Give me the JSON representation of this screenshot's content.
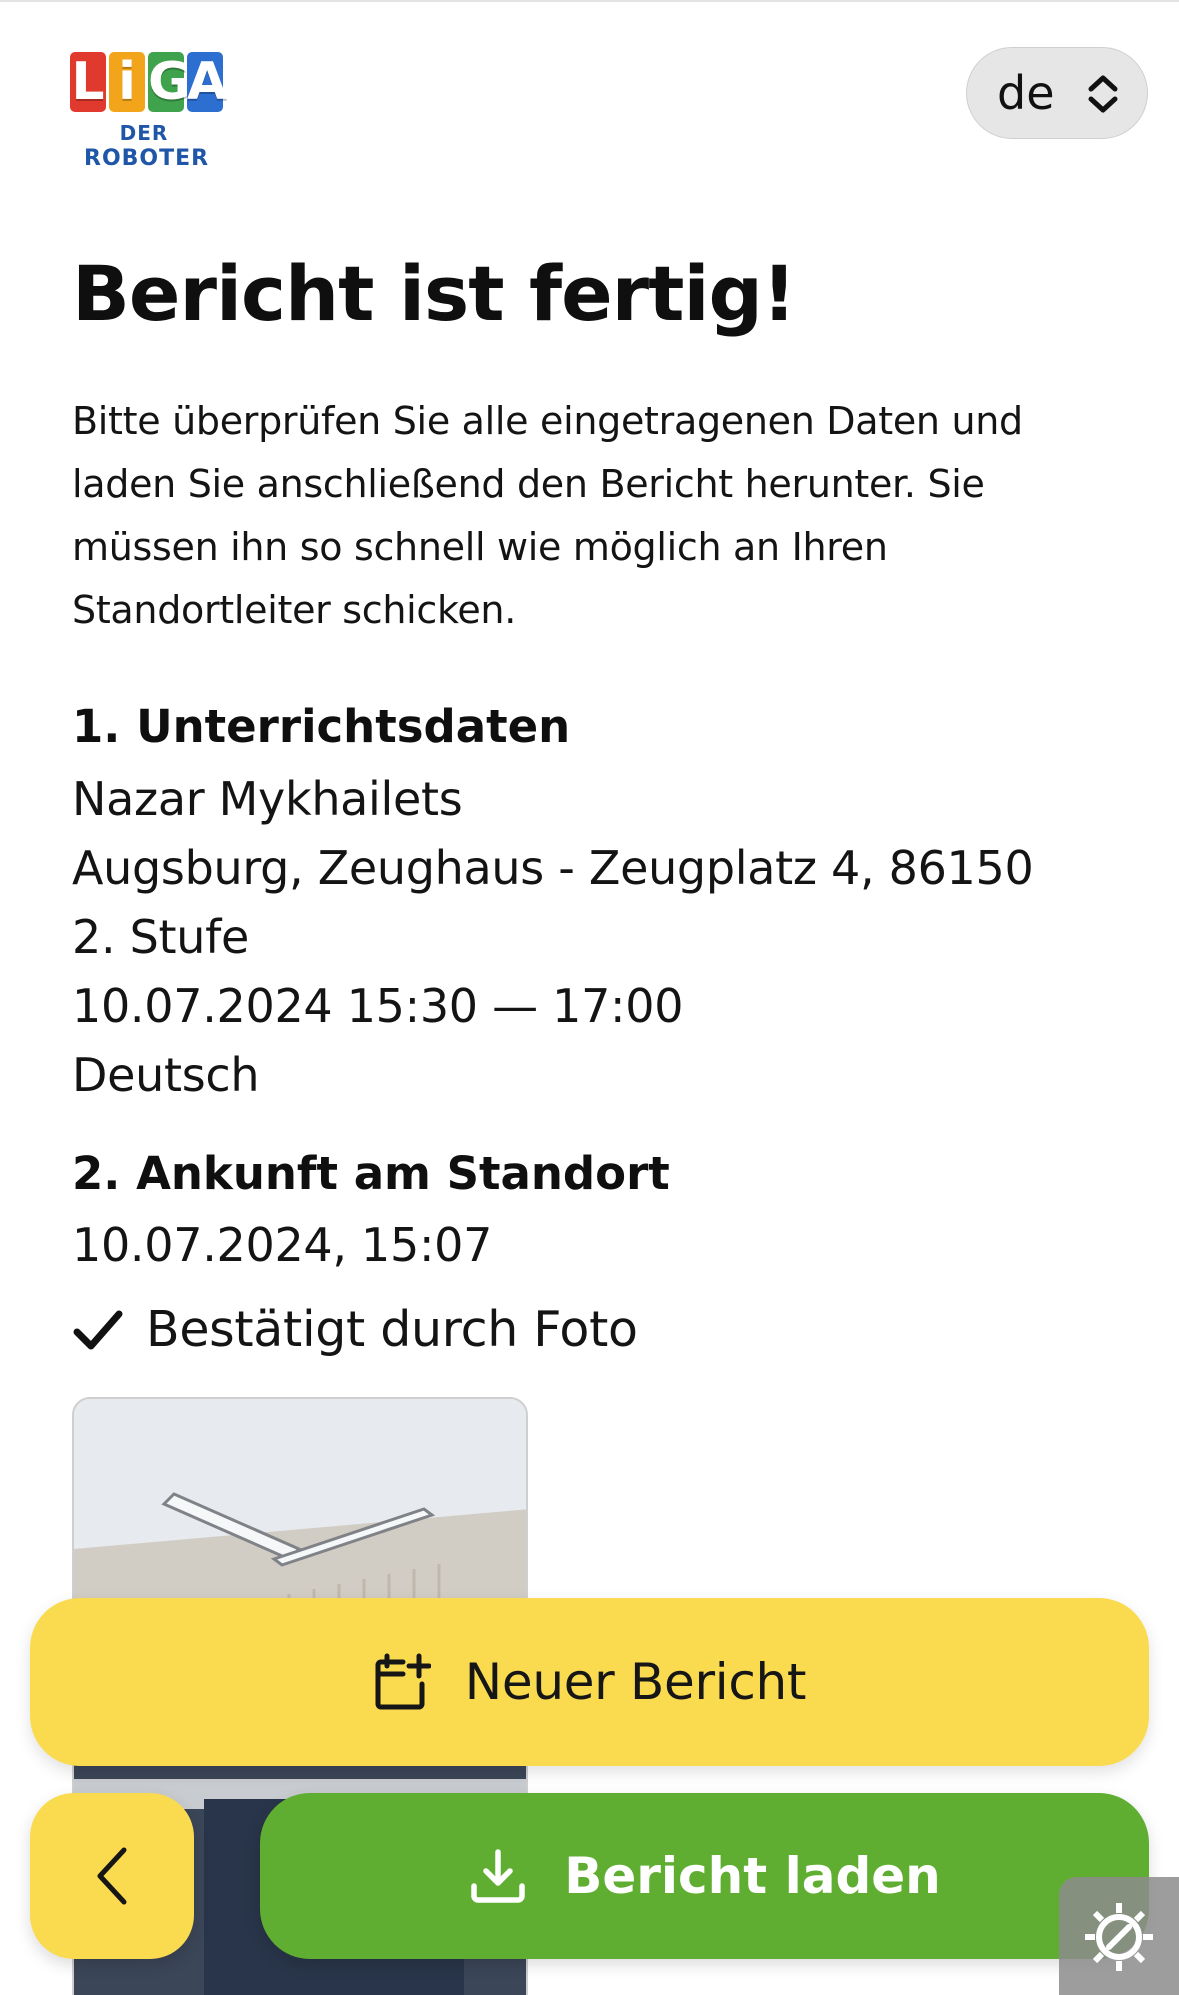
{
  "header": {
    "logo": {
      "letters": [
        "L",
        "i",
        "G",
        "A"
      ],
      "letter_colors": [
        "#e03a2f",
        "#f2a51a",
        "#3fa34d",
        "#2c6fd1"
      ],
      "line_der": "DER",
      "line_roboter": "ROBOTER"
    },
    "language": {
      "value": "de",
      "icon": "chevron-up-down-icon"
    }
  },
  "main": {
    "title": "Bericht ist fertig!",
    "intro": "Bitte überprüfen Sie alle eingetragenen Daten und laden Sie anschließend den Bericht herunter. Sie müssen ihn so schnell wie möglich an Ihren Standortleiter schicken.",
    "lesson": {
      "title": "1. Unterrichtsdaten",
      "teacher": "Nazar Mykhailets",
      "location": "Augsburg, Zeughaus - Zeugplatz 4, 86150",
      "level": "2. Stufe",
      "datetime": "10.07.2024 15:30 — 17:00",
      "language": "Deutsch"
    },
    "arrival": {
      "title": "2. Ankunft am Standort",
      "datetime": "10.07.2024, 15:07",
      "confirmation": "Bestätigt durch Foto",
      "confirmation_icon": "check-icon"
    }
  },
  "actions": {
    "new_report": {
      "label": "Neuer Bericht",
      "icon": "calendar-plus-icon"
    },
    "back": {
      "icon": "chevron-left-icon"
    },
    "download": {
      "label": "Bericht laden",
      "icon": "download-icon"
    },
    "settings": {
      "icon": "gear-icon"
    }
  },
  "colors": {
    "primary_yellow": "#fadb4f",
    "primary_green": "#5fae32",
    "text": "#0f0f0f",
    "select_bg": "#e6e6e6"
  }
}
